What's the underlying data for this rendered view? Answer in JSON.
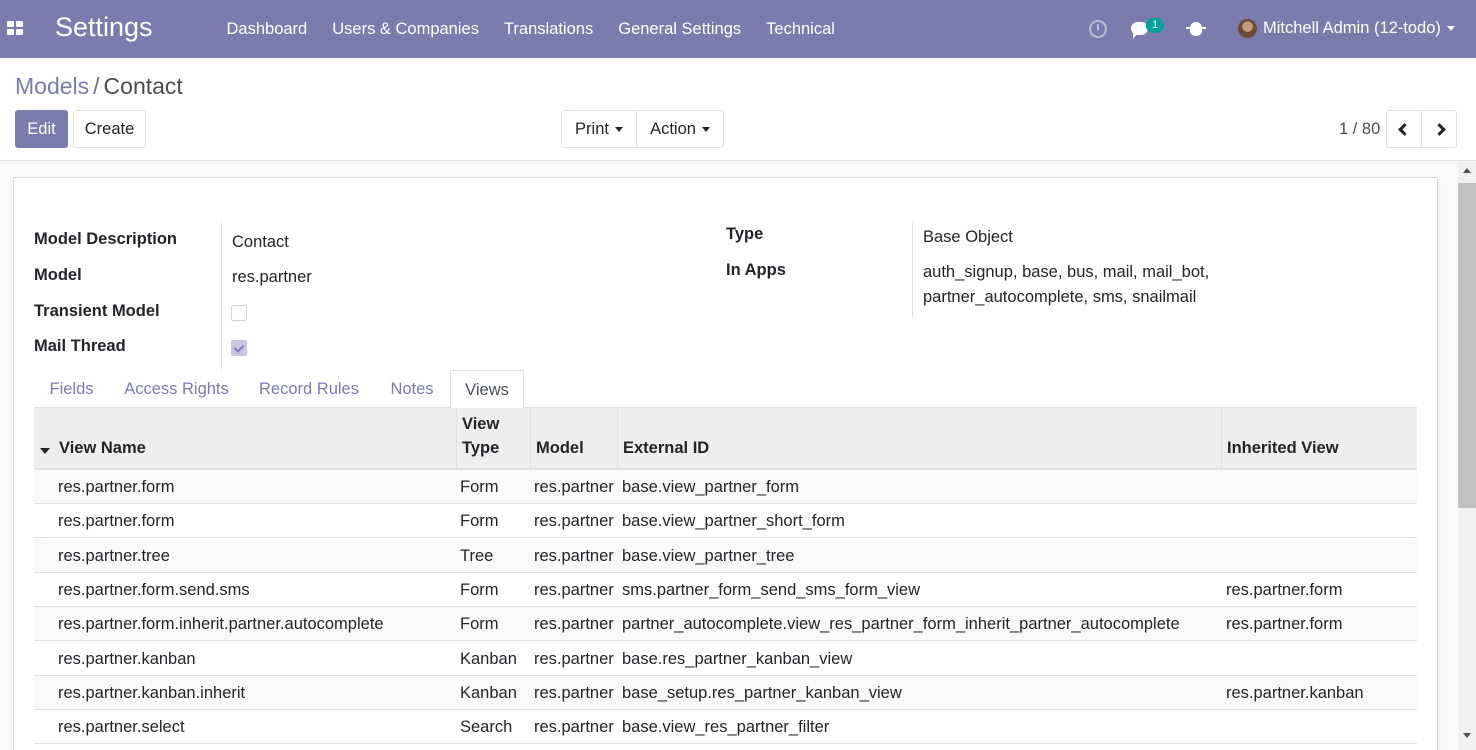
{
  "navbar": {
    "app_title": "Settings",
    "menu": [
      "Dashboard",
      "Users & Companies",
      "Translations",
      "General Settings",
      "Technical"
    ],
    "chat_count": "1",
    "user_name": "Mitchell Admin (12-todo)"
  },
  "breadcrumb": {
    "parent": "Models",
    "separator": "/",
    "current": "Contact"
  },
  "buttons": {
    "edit": "Edit",
    "create": "Create",
    "print": "Print",
    "action": "Action"
  },
  "pager": {
    "value": "1 / 80"
  },
  "form": {
    "model_description_label": "Model Description",
    "model_description": "Contact",
    "model_label": "Model",
    "model": "res.partner",
    "transient_label": "Transient Model",
    "transient": false,
    "mail_thread_label": "Mail Thread",
    "mail_thread": true,
    "type_label": "Type",
    "type": "Base Object",
    "in_apps_label": "In Apps",
    "in_apps_line1": "auth_signup, base, bus, mail, mail_bot,",
    "in_apps_line2": "partner_autocomplete, sms, snailmail"
  },
  "tabs": [
    "Fields",
    "Access Rights",
    "Record Rules",
    "Notes",
    "Views"
  ],
  "active_tab": "Views",
  "table": {
    "headers": {
      "view_name": "View Name",
      "view_type_1": "View",
      "view_type_2": "Type",
      "model": "Model",
      "external_id": "External ID",
      "inherited_view": "Inherited View"
    },
    "rows": [
      {
        "name": "res.partner.form",
        "type": "Form",
        "model": "res.partner",
        "xml_id": "base.view_partner_form",
        "inherited": ""
      },
      {
        "name": "res.partner.form",
        "type": "Form",
        "model": "res.partner",
        "xml_id": "base.view_partner_short_form",
        "inherited": ""
      },
      {
        "name": "res.partner.tree",
        "type": "Tree",
        "model": "res.partner",
        "xml_id": "base.view_partner_tree",
        "inherited": ""
      },
      {
        "name": "res.partner.form.send.sms",
        "type": "Form",
        "model": "res.partner",
        "xml_id": "sms.partner_form_send_sms_form_view",
        "inherited": "res.partner.form"
      },
      {
        "name": "res.partner.form.inherit.partner.autocomplete",
        "type": "Form",
        "model": "res.partner",
        "xml_id": "partner_autocomplete.view_res_partner_form_inherit_partner_autocomplete",
        "inherited": "res.partner.form"
      },
      {
        "name": "res.partner.kanban",
        "type": "Kanban",
        "model": "res.partner",
        "xml_id": "base.res_partner_kanban_view",
        "inherited": ""
      },
      {
        "name": "res.partner.kanban.inherit",
        "type": "Kanban",
        "model": "res.partner",
        "xml_id": "base_setup.res_partner_kanban_view",
        "inherited": "res.partner.kanban"
      },
      {
        "name": "res.partner.select",
        "type": "Search",
        "model": "res.partner",
        "xml_id": "base.view_res_partner_filter",
        "inherited": ""
      }
    ]
  },
  "colors": {
    "brand": "#7c7bad",
    "badge": "#00a09d"
  },
  "icons": [
    "apps-icon",
    "clock-icon",
    "chat-icon",
    "bug-icon",
    "avatar",
    "chevron-left-icon",
    "chevron-right-icon"
  ]
}
